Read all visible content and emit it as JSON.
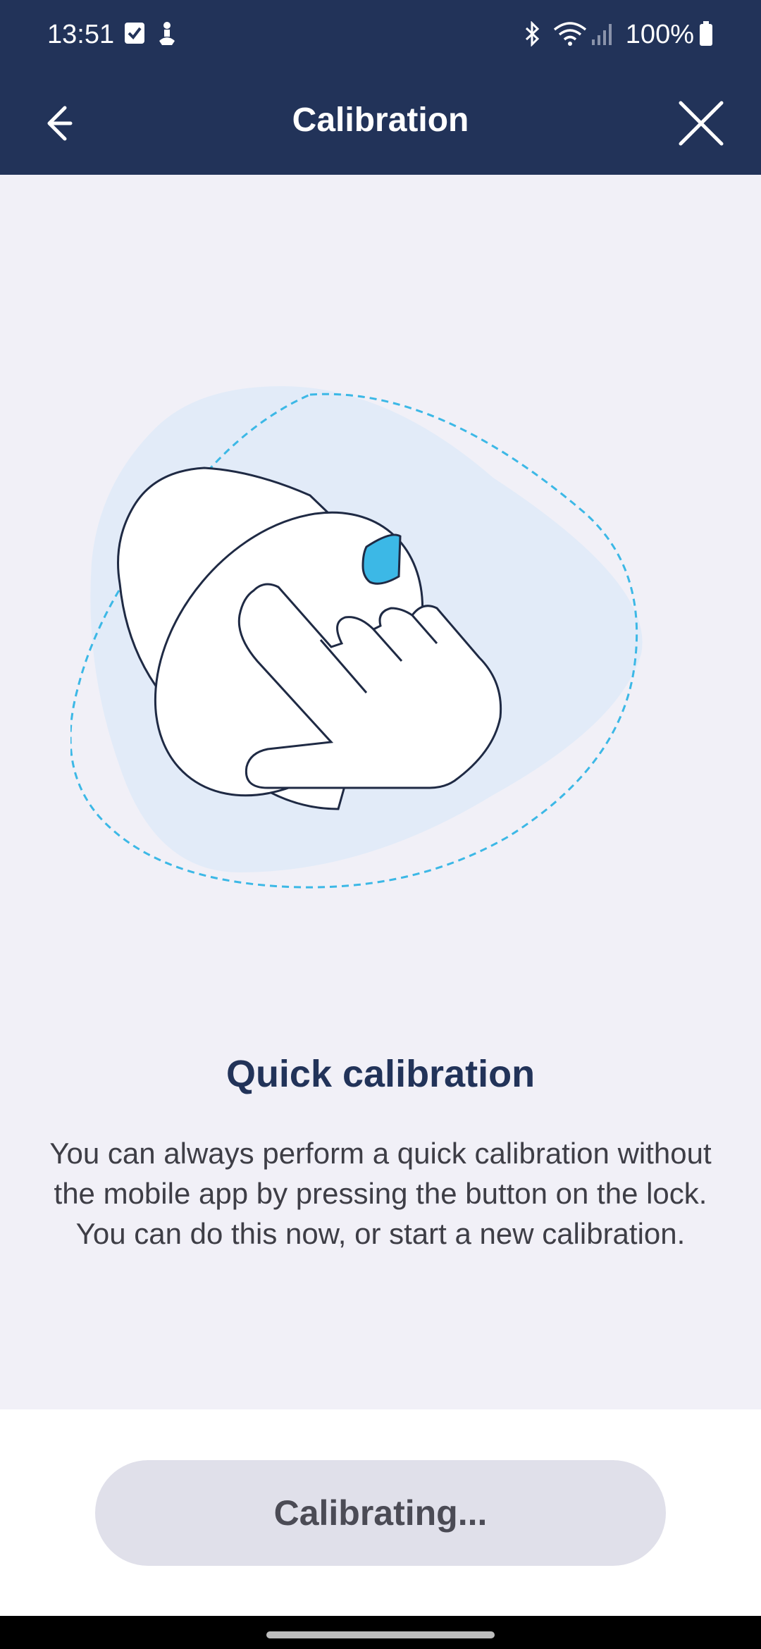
{
  "status_bar": {
    "time": "13:51",
    "battery": "100%",
    "icons": [
      "checkbox-notification-icon",
      "accessibility-icon",
      "bluetooth-icon",
      "wifi-icon",
      "cellular-signal-icon",
      "battery-icon"
    ]
  },
  "app_bar": {
    "title": "Calibration",
    "back_icon": "arrow-left-icon",
    "close_icon": "close-icon"
  },
  "main": {
    "heading": "Quick calibration",
    "description": "You can always perform a quick calibration without the mobile app by pressing the button on the lock. You can do this now, or start a new calibration."
  },
  "footer": {
    "button_label": "Calibrating..."
  },
  "colors": {
    "header_bg": "#223359",
    "page_bg": "#f1f0f7",
    "accent": "#3cb8e6",
    "button_bg": "#e0e0ea"
  }
}
